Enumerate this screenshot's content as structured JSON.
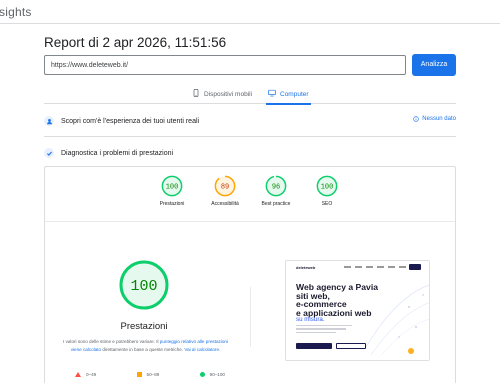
{
  "app": {
    "name": "sights"
  },
  "report": {
    "title": "Report di 2 apr 2026, 11:51:56",
    "url_value": "https://www.deleteweb.it/",
    "analyze_label": "Analizza"
  },
  "tabs": [
    {
      "label": "Dispositivi mobili",
      "icon": "smartphone-icon",
      "selected": false
    },
    {
      "label": "Computer",
      "icon": "desktop-icon",
      "selected": true
    }
  ],
  "real_users": {
    "label": "Scopri com'è l'esperienza dei tuoi utenti reali",
    "no_data": "Nessun dato"
  },
  "diagnostics": {
    "label": "Diagnostica i problemi di prestazioni"
  },
  "scores": [
    {
      "title": "Prestazioni",
      "value": "100",
      "color": "#0cce6b"
    },
    {
      "title": "Accessibilità",
      "value": "89",
      "color": "#ffa400"
    },
    {
      "title": "Best practice",
      "value": "96",
      "color": "#0cce6b"
    },
    {
      "title": "SEO",
      "value": "100",
      "color": "#0cce6b"
    }
  ],
  "main_score": {
    "value": "100",
    "title": "Prestazioni",
    "color": "#0cce6b"
  },
  "description": {
    "part1": "I valori sono delle stime e potrebbero variare. Il ",
    "link1": "punteggio relativo alle prestazioni viene calcolato",
    "part2": " direttamente in base a queste metriche. ",
    "link2": "Vai al calcolatore."
  },
  "legend": [
    {
      "range": "0–49",
      "shape": "triangle",
      "color": "#ff4e42"
    },
    {
      "range": "50–89",
      "shape": "square",
      "color": "#ffa400"
    },
    {
      "range": "90–100",
      "shape": "circle",
      "color": "#0cce6b"
    }
  ],
  "preview": {
    "logo": "deleteweb",
    "headline": [
      "Web agency a Pavia",
      "siti web,",
      "e-commerce",
      "e applicazioni web"
    ],
    "sub": "su misura."
  }
}
